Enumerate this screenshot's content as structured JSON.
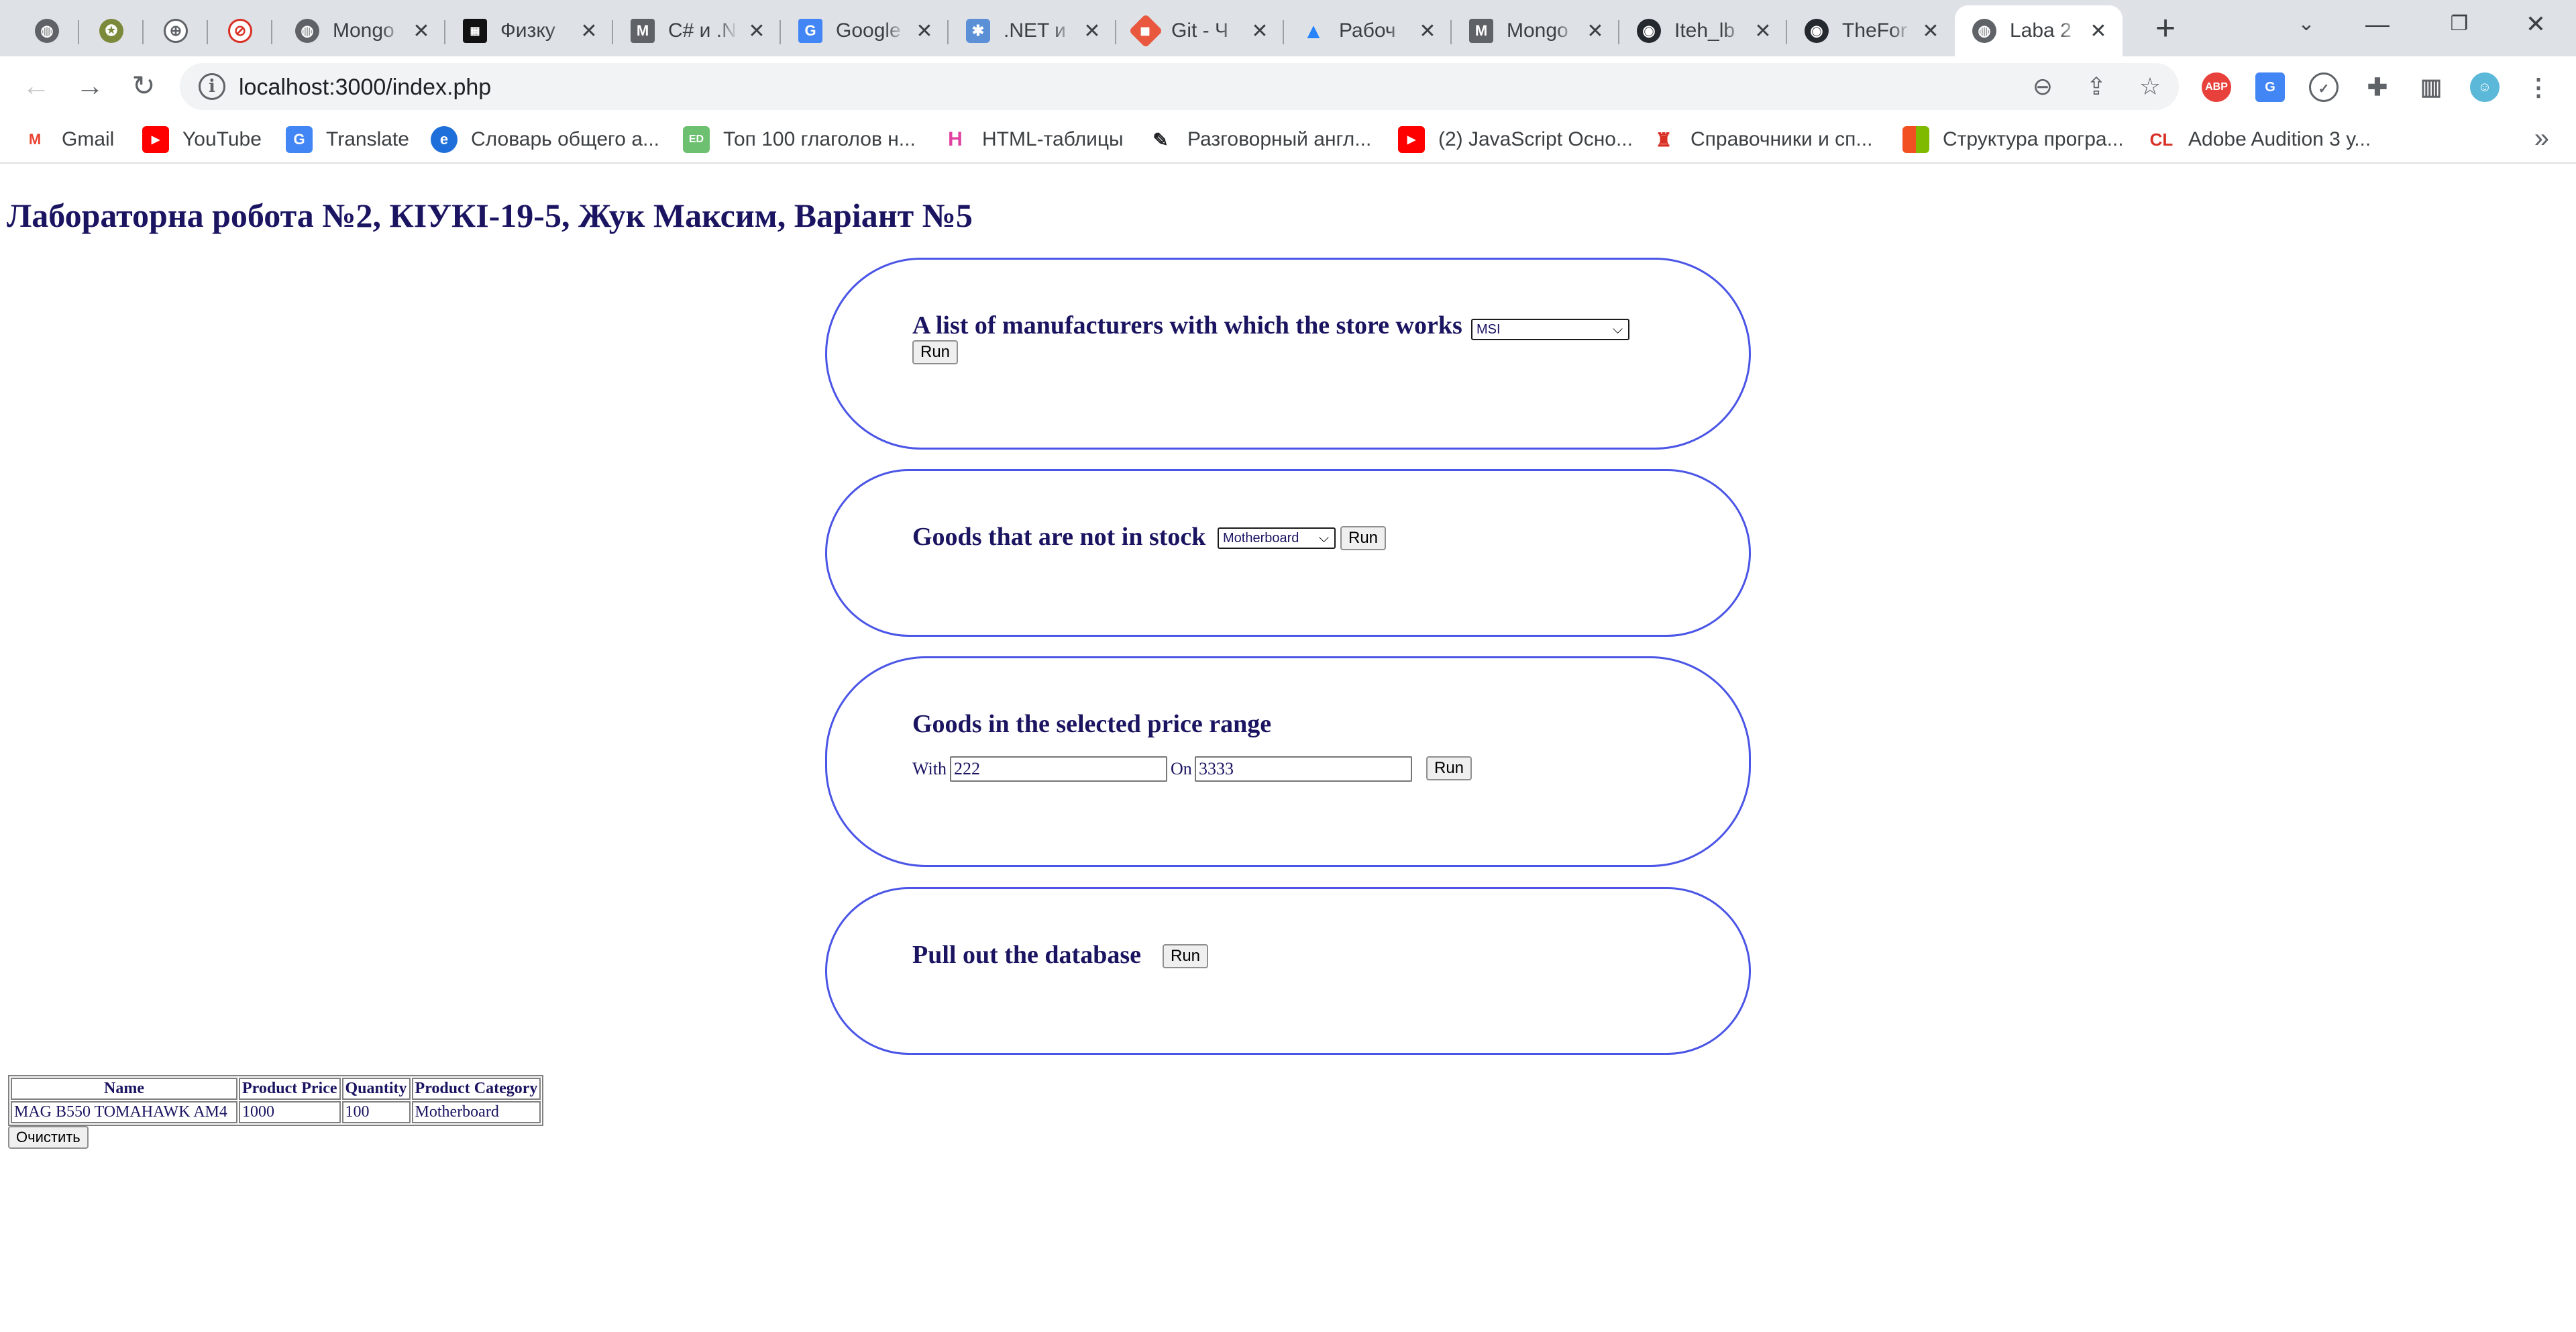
{
  "browser": {
    "tabs": [
      {
        "title": "",
        "icon": "globe-icon"
      },
      {
        "title": "",
        "icon": "crest-icon"
      },
      {
        "title": "",
        "icon": "network-globe-icon"
      },
      {
        "title": "",
        "icon": "no-sign-icon"
      },
      {
        "title": "Mongo",
        "icon": "globe-icon"
      },
      {
        "title": "Физку",
        "icon": "site-logo-icon"
      },
      {
        "title": "C# и .N",
        "icon": "gmail-m-icon"
      },
      {
        "title": "Google",
        "icon": "google-translate-icon"
      },
      {
        "title": ".NET и",
        "icon": "dotnet-icon"
      },
      {
        "title": "Git - Ч",
        "icon": "git-icon"
      },
      {
        "title": "Рабоч",
        "icon": "atlassian-icon"
      },
      {
        "title": "Mongo",
        "icon": "gmail-m-icon"
      },
      {
        "title": "Iteh_lb",
        "icon": "github-icon"
      },
      {
        "title": "TheFor",
        "icon": "github-icon"
      },
      {
        "title": "Laba 2",
        "icon": "globe-icon",
        "active": true
      }
    ],
    "url": "localhost:3000/index.php",
    "bookmarks": [
      {
        "label": "Gmail",
        "icon": "gmail-icon"
      },
      {
        "label": "YouTube",
        "icon": "youtube-icon"
      },
      {
        "label": "Translate",
        "icon": "google-translate-icon"
      },
      {
        "label": "Словарь общего а...",
        "icon": "e-dictionary-icon"
      },
      {
        "label": "Топ 100 глаголов н...",
        "icon": "ed-icon"
      },
      {
        "label": "HTML-таблицы",
        "icon": "html-h-icon"
      },
      {
        "label": "Разговорный англ...",
        "icon": "scroll-icon"
      },
      {
        "label": "(2) JavaScript Осно...",
        "icon": "youtube-icon"
      },
      {
        "label": "Справочники и сп...",
        "icon": "tower-icon"
      },
      {
        "label": "Структура програ...",
        "icon": "microsoft-icon"
      },
      {
        "label": "Adobe Audition 3 у...",
        "icon": "cl-icon"
      }
    ]
  },
  "page": {
    "title": "Лабораторна робота №2, КІУКІ-19-5, Жук Максим, Варіант №5",
    "manufacturers": {
      "heading": "A list of manufacturers with which the store works",
      "selected": "MSI",
      "run_label": "Run"
    },
    "out_of_stock": {
      "heading": "Goods that are not in stock",
      "selected": "Motherboard",
      "run_label": "Run"
    },
    "price_range": {
      "heading": "Goods in the selected price range",
      "with_label": "With",
      "with_value": "222",
      "on_label": "On",
      "on_value": "3333",
      "run_label": "Run"
    },
    "database": {
      "heading": "Pull out the database",
      "run_label": "Run"
    },
    "results": {
      "columns": [
        "Name",
        "Product Price",
        "Quantity",
        "Product Category"
      ],
      "rows": [
        [
          "MAG B550 TOMAHAWK AM4",
          "1000",
          "100",
          "Motherboard"
        ]
      ],
      "clear_label": "Очистить"
    }
  }
}
